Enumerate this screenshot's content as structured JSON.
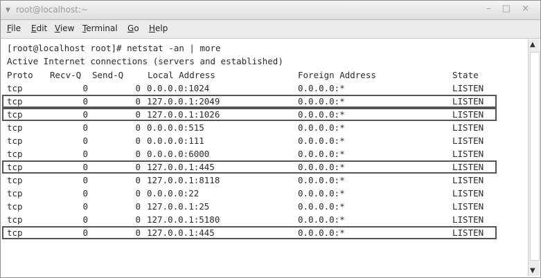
{
  "window": {
    "title": "root@localhost:~",
    "controls": "– □ ×",
    "menu_icon": "chevron-down-icon"
  },
  "menubar": {
    "items": [
      {
        "label": "File",
        "mnemonic_index": 0
      },
      {
        "label": "Edit",
        "mnemonic_index": 0
      },
      {
        "label": "View",
        "mnemonic_index": 0
      },
      {
        "label": "Terminal",
        "mnemonic_index": 0
      },
      {
        "label": "Go",
        "mnemonic_index": 0
      },
      {
        "label": "Help",
        "mnemonic_index": 0
      }
    ]
  },
  "terminal": {
    "prompt_line": "[root@localhost root]# netstat -an | more",
    "info_line": "Active Internet connections (servers and established)",
    "headers": {
      "proto": "Proto",
      "recv": "Recv-Q",
      "send": "Send-Q",
      "local": "Local Address",
      "foreign": "Foreign Address",
      "state": "State"
    },
    "rows": [
      {
        "proto": "tcp",
        "recv": "0",
        "send": "0",
        "local": "0.0.0.0:1024",
        "foreign": "0.0.0.0:*",
        "state": "LISTEN",
        "highlighted": false
      },
      {
        "proto": "tcp",
        "recv": "0",
        "send": "0",
        "local": "127.0.0.1:2049",
        "foreign": "0.0.0.0:*",
        "state": "LISTEN",
        "highlighted": true
      },
      {
        "proto": "tcp",
        "recv": "0",
        "send": "0",
        "local": "127.0.0.1:1026",
        "foreign": "0.0.0.0:*",
        "state": "LISTEN",
        "highlighted": true
      },
      {
        "proto": "tcp",
        "recv": "0",
        "send": "0",
        "local": "0.0.0.0:515",
        "foreign": "0.0.0.0:*",
        "state": "LISTEN",
        "highlighted": false
      },
      {
        "proto": "tcp",
        "recv": "0",
        "send": "0",
        "local": "0.0.0.0:111",
        "foreign": "0.0.0.0:*",
        "state": "LISTEN",
        "highlighted": false
      },
      {
        "proto": "tcp",
        "recv": "0",
        "send": "0",
        "local": "0.0.0.0:6000",
        "foreign": "0.0.0.0:*",
        "state": "LISTEN",
        "highlighted": false
      },
      {
        "proto": "tcp",
        "recv": "0",
        "send": "0",
        "local": "127.0.0.1:445",
        "foreign": "0.0.0.0:*",
        "state": "LISTEN",
        "highlighted": true
      },
      {
        "proto": "tcp",
        "recv": "0",
        "send": "0",
        "local": "127.0.0.1:8118",
        "foreign": "0.0.0.0:*",
        "state": "LISTEN",
        "highlighted": false
      },
      {
        "proto": "tcp",
        "recv": "0",
        "send": "0",
        "local": "0.0.0.0:22",
        "foreign": "0.0.0.0:*",
        "state": "LISTEN",
        "highlighted": false
      },
      {
        "proto": "tcp",
        "recv": "0",
        "send": "0",
        "local": "127.0.0.1:25",
        "foreign": "0.0.0.0:*",
        "state": "LISTEN",
        "highlighted": false
      },
      {
        "proto": "tcp",
        "recv": "0",
        "send": "0",
        "local": "127.0.0.1:5180",
        "foreign": "0.0.0.0:*",
        "state": "LISTEN",
        "highlighted": false
      },
      {
        "proto": "tcp",
        "recv": "0",
        "send": "0",
        "local": "127.0.0.1:445",
        "foreign": "0.0.0.0:*",
        "state": "LISTEN",
        "highlighted": true
      }
    ]
  },
  "scrollbar": {
    "up_icon": "arrow-up-icon",
    "down_icon": "arrow-down-icon"
  },
  "colors": {
    "highlight_box": "#555555",
    "text": "#2a2a2a"
  }
}
